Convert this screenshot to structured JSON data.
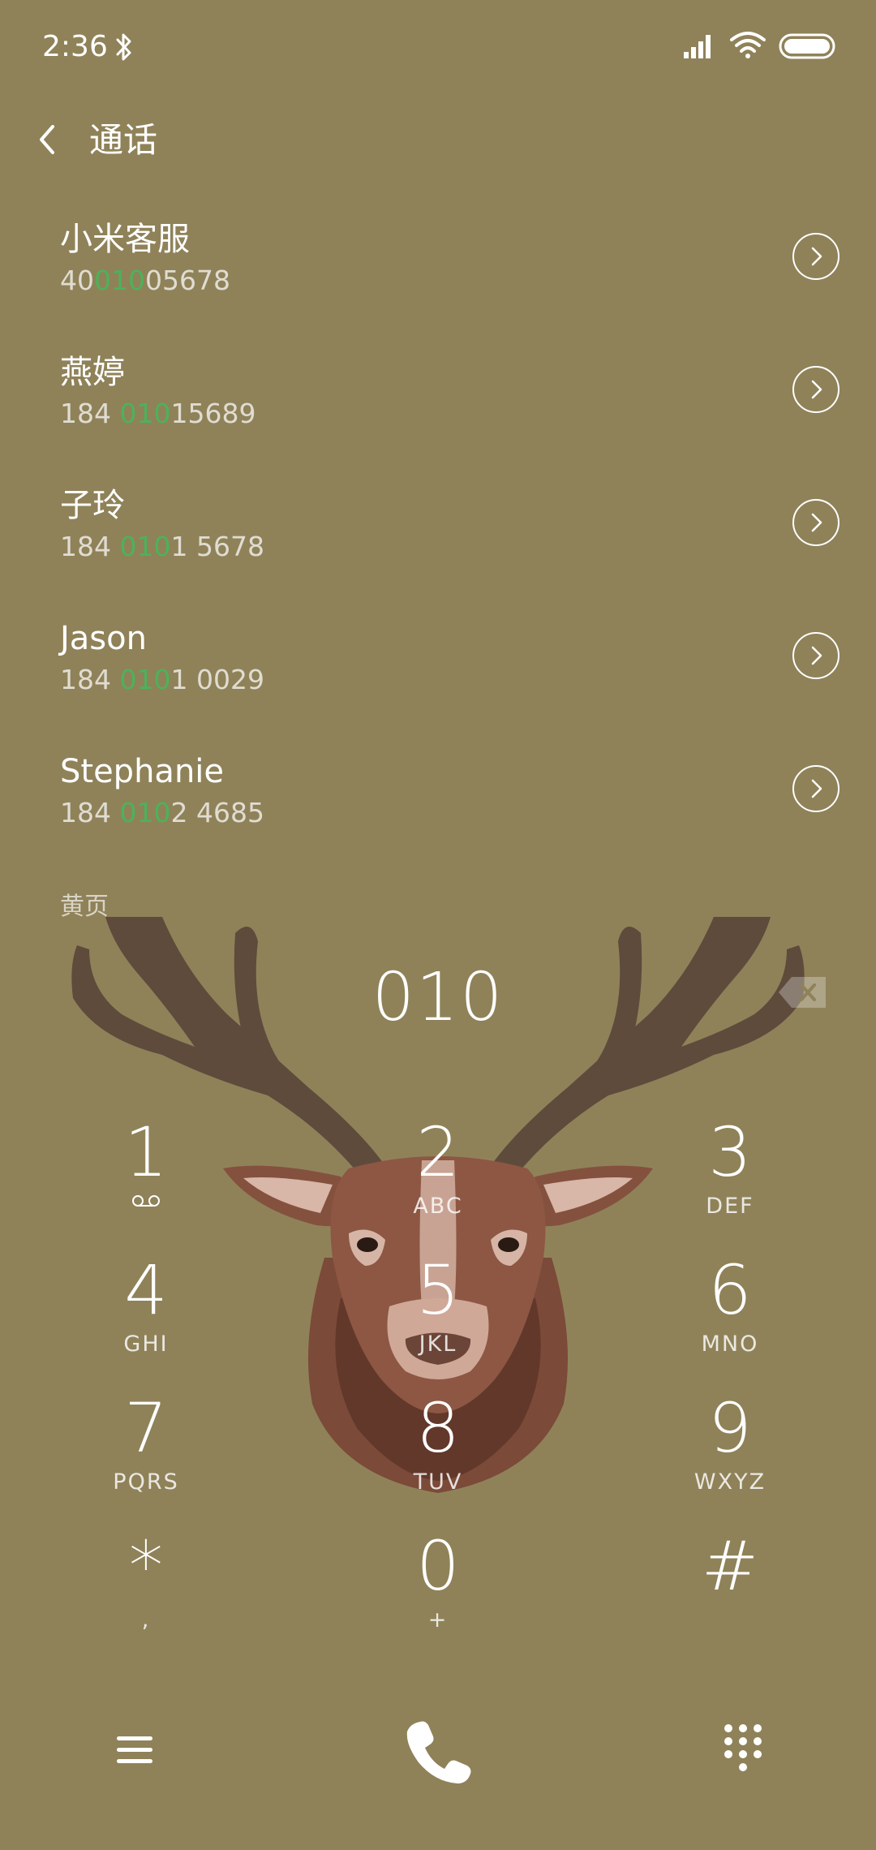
{
  "status_bar": {
    "time": "2:36",
    "icons": [
      "bluetooth-icon",
      "signal-icon",
      "wifi-icon",
      "battery-icon"
    ]
  },
  "header": {
    "title": "通话",
    "back_icon": "chevron-left-icon"
  },
  "contacts": [
    {
      "name": "小米客服",
      "number_prefix": "40",
      "number_match": "010",
      "number_suffix": "05678"
    },
    {
      "name": "燕婷",
      "number_prefix": "184 ",
      "number_match": "010",
      "number_suffix": "15689"
    },
    {
      "name": "子玲",
      "number_prefix": "184 ",
      "number_match": "010",
      "number_suffix": "1 5678"
    },
    {
      "name": "Jason",
      "number_prefix": "184 ",
      "number_match": "010",
      "number_suffix": "1 0029"
    },
    {
      "name": "Stephanie",
      "number_prefix": "184 ",
      "number_match": "010",
      "number_suffix": "2 4685"
    }
  ],
  "section_label": "黄页",
  "dialer": {
    "display": "010",
    "delete_icon": "backspace-icon"
  },
  "keypad": {
    "keys": [
      {
        "digit": "1",
        "letters": "",
        "icon": "voicemail-icon"
      },
      {
        "digit": "2",
        "letters": "ABC"
      },
      {
        "digit": "3",
        "letters": "DEF"
      },
      {
        "digit": "4",
        "letters": "GHI"
      },
      {
        "digit": "5",
        "letters": "JKL"
      },
      {
        "digit": "6",
        "letters": "MNO"
      },
      {
        "digit": "7",
        "letters": "PQRS"
      },
      {
        "digit": "8",
        "letters": "TUV"
      },
      {
        "digit": "9",
        "letters": "WXYZ"
      },
      {
        "digit": "*",
        "letters": ","
      },
      {
        "digit": "0",
        "letters": "+"
      },
      {
        "digit": "#",
        "letters": ""
      }
    ]
  },
  "bottom_bar": {
    "icons": [
      "menu-icon",
      "phone-icon",
      "dialpad-icon"
    ]
  },
  "colors": {
    "background": "#8f8259",
    "match_highlight": "#4cb25a",
    "text": "#ffffff"
  }
}
